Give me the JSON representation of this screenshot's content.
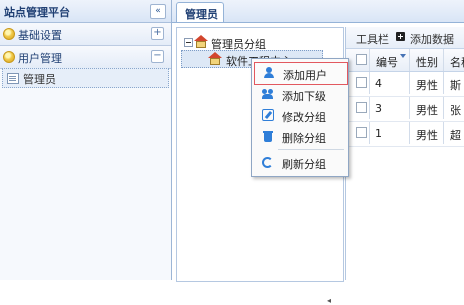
{
  "sidebar": {
    "title": "站点管理平台",
    "collapse_symbol": "«",
    "sections": [
      {
        "label": "基础设置",
        "toggle": "+"
      },
      {
        "label": "用户管理",
        "toggle": "−"
      }
    ],
    "active_item": "管理员"
  },
  "tabs": [
    {
      "label": "管理员"
    }
  ],
  "tree": {
    "root": "管理员分组",
    "child": "软件工程中心"
  },
  "context_menu": {
    "items": [
      {
        "label": "添加用户",
        "icon": "user-icon"
      },
      {
        "label": "添加下级",
        "icon": "users-icon"
      },
      {
        "label": "修改分组",
        "icon": "edit-icon"
      },
      {
        "label": "删除分组",
        "icon": "trash-icon"
      },
      {
        "label": "刷新分组",
        "icon": "refresh-icon"
      }
    ]
  },
  "grid": {
    "toolbar_label": "工具栏",
    "add_label": "添加数据",
    "columns": [
      "编号",
      "性别",
      "名称"
    ],
    "rows": [
      {
        "id": "4",
        "gender": "男性",
        "name": "斯"
      },
      {
        "id": "3",
        "gender": "男性",
        "name": "张"
      },
      {
        "id": "1",
        "gender": "男性",
        "name": "超"
      }
    ]
  },
  "colors": {
    "accent": "#2f7ed8",
    "menu_active_border": "#e2585f",
    "header_text": "#1f3f73"
  }
}
